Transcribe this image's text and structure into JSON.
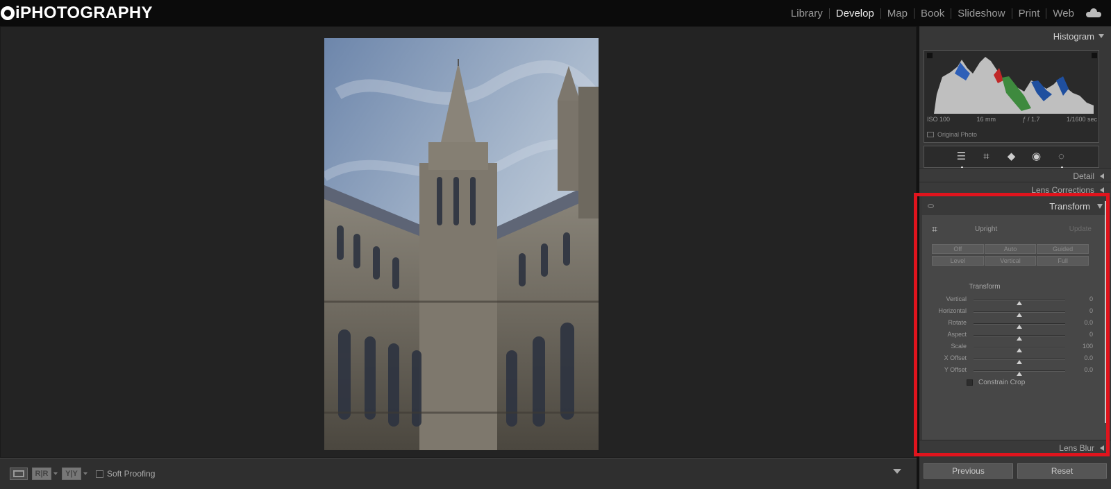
{
  "brand": {
    "logo_text": "iPHOTOGRAPHY"
  },
  "modules": [
    {
      "label": "Library",
      "active": false
    },
    {
      "label": "Develop",
      "active": true
    },
    {
      "label": "Map",
      "active": false
    },
    {
      "label": "Book",
      "active": false
    },
    {
      "label": "Slideshow",
      "active": false
    },
    {
      "label": "Print",
      "active": false
    },
    {
      "label": "Web",
      "active": false
    }
  ],
  "histogram": {
    "title": "Histogram",
    "exif": {
      "iso": "ISO 100",
      "focal": "16 mm",
      "aperture": "ƒ / 1.7",
      "shutter": "1/1600 sec"
    },
    "original_photo_label": "Original Photo"
  },
  "panels": {
    "detail": "Detail",
    "lens_corrections": "Lens Corrections",
    "lens_blur": "Lens Blur"
  },
  "transform": {
    "title": "Transform",
    "upright_label": "Upright",
    "update_label": "Update",
    "upright_buttons": [
      "Off",
      "Auto",
      "Guided",
      "Level",
      "Vertical",
      "Full"
    ],
    "section_label": "Transform",
    "sliders": [
      {
        "label": "Vertical",
        "value": "0",
        "pos": 0.5
      },
      {
        "label": "Horizontal",
        "value": "0",
        "pos": 0.5
      },
      {
        "label": "Rotate",
        "value": "0.0",
        "pos": 0.5
      },
      {
        "label": "Aspect",
        "value": "0",
        "pos": 0.5
      },
      {
        "label": "Scale",
        "value": "100",
        "pos": 0.5
      },
      {
        "label": "X Offset",
        "value": "0.0",
        "pos": 0.5
      },
      {
        "label": "Y Offset",
        "value": "0.0",
        "pos": 0.5
      }
    ],
    "constrain_crop_label": "Constrain Crop"
  },
  "toolbar": {
    "compare_label_1": "R|R",
    "compare_label_2": "Y|Y",
    "soft_proofing_label": "Soft Proofing"
  },
  "buttons": {
    "previous": "Previous",
    "reset": "Reset"
  },
  "colors": {
    "highlight": "#e0141d",
    "panel_bg": "#373737",
    "canvas_bg": "#232323"
  }
}
